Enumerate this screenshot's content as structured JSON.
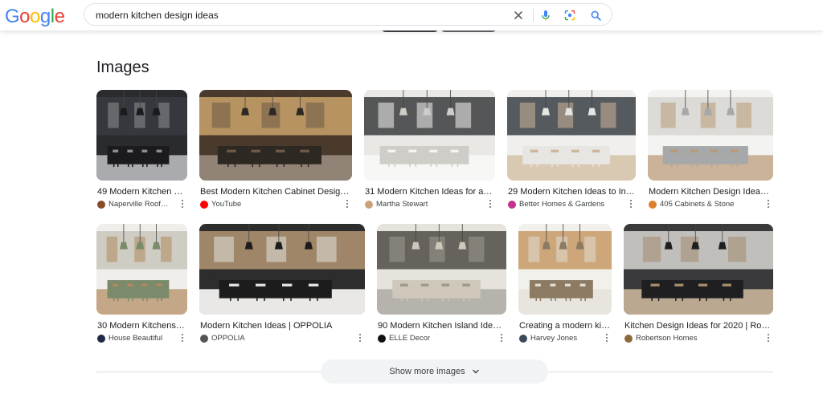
{
  "header": {
    "logo_text": "Google",
    "logo_colors": [
      "#4285F4",
      "#EA4335",
      "#FBBC05",
      "#4285F4",
      "#34A853",
      "#EA4335"
    ],
    "search_value": "modern kitchen design ideas",
    "icons": [
      "close-icon",
      "mic-icon",
      "lens-icon",
      "search-icon"
    ]
  },
  "section": {
    "title": "Images"
  },
  "row1": [
    {
      "title": "49 Modern Kitchen …",
      "source": "Naperville Roof…",
      "favicon": "roof",
      "favicon_color": "#8a4b2a",
      "palette": [
        "#2a2b2e",
        "#3a3b3f",
        "#8e8f93",
        "#1b1b1d"
      ]
    },
    {
      "title": "Best Modern Kitchen Cabinet Design…",
      "source": "YouTube",
      "favicon": "▶",
      "favicon_color": "#ff0000",
      "palette": [
        "#4a3a2c",
        "#c9a36a",
        "#6d5a48",
        "#2e2822"
      ]
    },
    {
      "title": "31 Modern Kitchen Ideas for a…",
      "source": "Martha Stewart",
      "favicon": "ms",
      "favicon_color": "#c9a27a",
      "palette": [
        "#e9e8e4",
        "#3b3c3e",
        "#f4f4f2",
        "#cfcdc8"
      ]
    },
    {
      "title": "29 Modern Kitchen Ideas to In…",
      "source": "Better Homes & Gardens",
      "favicon": "B",
      "favicon_color": "#c2338c",
      "palette": [
        "#f0efed",
        "#3a3f44",
        "#cdb79a",
        "#e8e6e2"
      ]
    },
    {
      "title": "Modern Kitchen Design Ideas…",
      "source": "405 Cabinets & Stone",
      "favicon": "405",
      "favicon_color": "#d9822b",
      "palette": [
        "#f3f3f1",
        "#d7d6d2",
        "#b89a76",
        "#a7a8aa"
      ]
    }
  ],
  "row2": [
    {
      "title": "30 Modern Kitchens …",
      "source": "House Beautiful",
      "favicon": "HB",
      "favicon_color": "#1f2a44",
      "palette": [
        "#efeeeb",
        "#c9c5bd",
        "#b08a5e",
        "#7b8a6a"
      ]
    },
    {
      "title": "Modern Kitchen Ideas | OPPOLIA",
      "source": "OPPOLIA",
      "favicon": "oo",
      "favicon_color": "#555555",
      "palette": [
        "#2d2d2e",
        "#b59772",
        "#e2e1de",
        "#1c1c1d"
      ]
    },
    {
      "title": "90 Modern Kitchen Island Idea…",
      "source": "ELLE Decor",
      "favicon": "elle",
      "favicon_color": "#111111",
      "palette": [
        "#e6e3dc",
        "#4f4c47",
        "#9c9a90",
        "#cfc8ba"
      ]
    },
    {
      "title": "Creating a modern ki…",
      "source": "Harvey Jones",
      "favicon": "HJ",
      "favicon_color": "#3a4a5a",
      "palette": [
        "#f2f0eb",
        "#c79a66",
        "#e0dcd4",
        "#8c7a62"
      ]
    },
    {
      "title": "Kitchen Design Ideas for 2020 | Ro…",
      "source": "Robertson Homes",
      "favicon": "RB",
      "favicon_color": "#8a6a3a",
      "palette": [
        "#3a3a3c",
        "#d9d7d2",
        "#a38b6b",
        "#1f1f21"
      ]
    }
  ],
  "more_button": {
    "label": "Show more images",
    "icon": "chevron-down-icon"
  }
}
